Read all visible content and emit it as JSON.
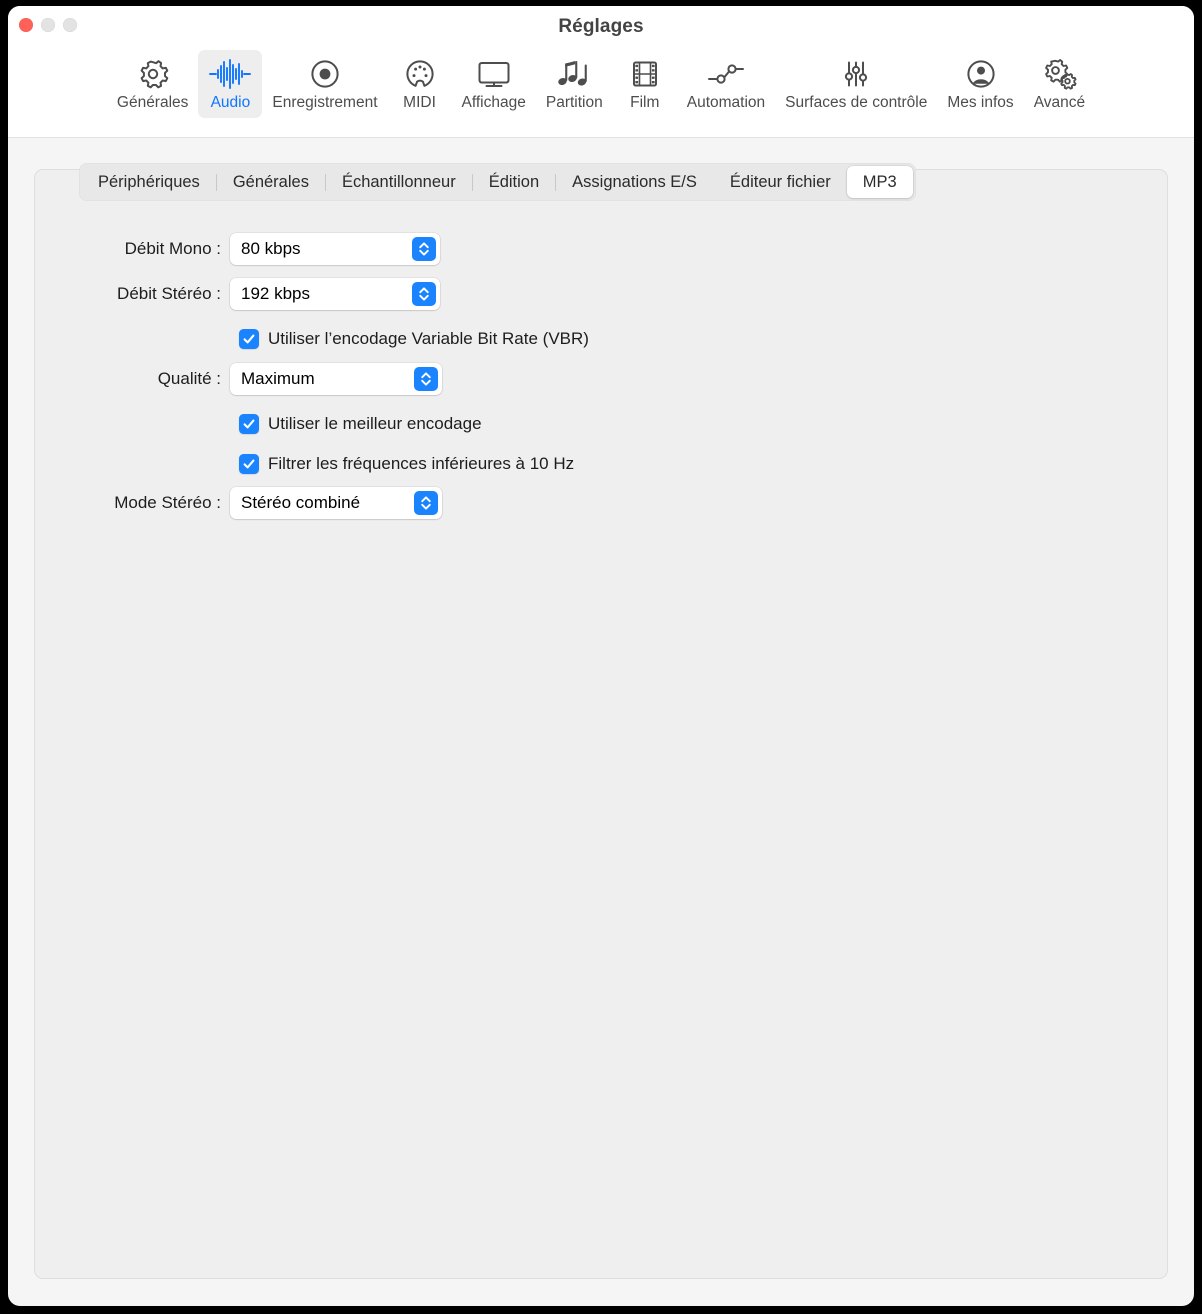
{
  "window": {
    "title": "Réglages",
    "traffic_lights": [
      "close-button",
      "minimize-button",
      "maximize-button"
    ]
  },
  "toolbar": {
    "items": [
      {
        "label": "Générales",
        "icon": "gear-icon",
        "selected": false
      },
      {
        "label": "Audio",
        "icon": "waveform-icon",
        "selected": true
      },
      {
        "label": "Enregistrement",
        "icon": "record-circle-icon",
        "selected": false
      },
      {
        "label": "MIDI",
        "icon": "midi-connector-icon",
        "selected": false
      },
      {
        "label": "Affichage",
        "icon": "display-monitor-icon",
        "selected": false
      },
      {
        "label": "Partition",
        "icon": "music-notes-icon",
        "selected": false
      },
      {
        "label": "Film",
        "icon": "film-strip-icon",
        "selected": false
      },
      {
        "label": "Automation",
        "icon": "automation-nodes-icon",
        "selected": false
      },
      {
        "label": "Surfaces de contrôle",
        "icon": "sliders-icon",
        "selected": false
      },
      {
        "label": "Mes infos",
        "icon": "user-circle-icon",
        "selected": false
      },
      {
        "label": "Avancé",
        "icon": "double-gear-icon",
        "selected": false
      }
    ]
  },
  "tabs": [
    {
      "label": "Périphériques",
      "selected": false
    },
    {
      "label": "Générales",
      "selected": false
    },
    {
      "label": "Échantillonneur",
      "selected": false
    },
    {
      "label": "Édition",
      "selected": false
    },
    {
      "label": "Assignations E/S",
      "selected": false
    },
    {
      "label": "Éditeur fichier",
      "selected": false
    },
    {
      "label": "MP3",
      "selected": true
    }
  ],
  "form": {
    "debit_mono": {
      "label": "Débit Mono :",
      "value": "80 kbps"
    },
    "debit_stereo": {
      "label": "Débit Stéréo :",
      "value": "192 kbps"
    },
    "vbr": {
      "label": "Utiliser l’encodage Variable Bit Rate (VBR)",
      "checked": true
    },
    "qualite": {
      "label": "Qualité :",
      "value": "Maximum"
    },
    "best_encoding": {
      "label": "Utiliser le meilleur encodage",
      "checked": true
    },
    "filter_freq": {
      "label": "Filtrer les fréquences inférieures à 10 Hz",
      "checked": true
    },
    "mode_stereo": {
      "label": "Mode Stéréo :",
      "value": "Stéréo combiné"
    }
  },
  "colors": {
    "accent_blue": "#1a84ff",
    "selected_tab_text": "#1076ff",
    "window_bg": "#f5f5f5",
    "pane_bg": "#efefef",
    "titlebar_bg": "#ffffff",
    "close_light": "#ff6159",
    "inactive_light": "#e3e3e3"
  }
}
